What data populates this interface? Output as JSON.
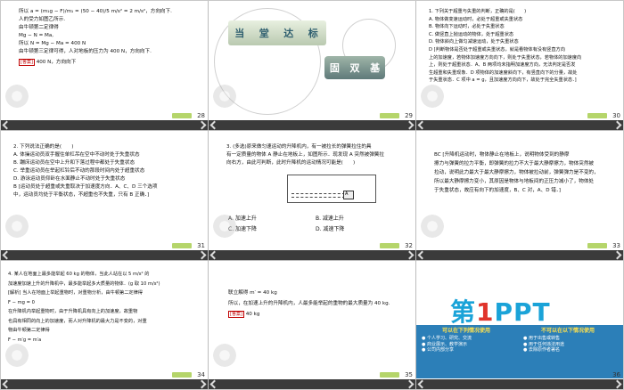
{
  "slides": [
    {
      "number": "28",
      "lines": [
        "所以 a = (m₁g − F)/m₁ = (50 − 40)/5 m/s² = 2 m/s²，方向向下.",
        "人的受力如图乙所示.",
        "由牛顿第二定律得",
        "Mg − N = Ma,",
        "所以 N = Mg − Ma = 400 N",
        "由牛顿第三定律可得，人对地板的压力为 400 N，方向向下."
      ],
      "answer_tag": "[答案]",
      "answer": "400 N，方向向下"
    },
    {
      "number": "29",
      "title_chars": [
        "当",
        "堂",
        "达",
        "标"
      ],
      "subtitle_chars": [
        "固",
        "双",
        "基"
      ]
    },
    {
      "number": "30",
      "lines": [
        "1. 下列关于超重与失重的判断，正确的是(　　)",
        "A. 物体做变速运动时，必处于超重或失重状态",
        "B. 物体向下运动时，必处于失重状态",
        "C. 做竖直上抛运动的物体，处于超重状态",
        "D. 物体斜向上做匀减速运动，处于失重状态",
        "D [判断物体是否处于超重或失重状态，就是看物体有没有竖直方向",
        "上的加速度，若物体加速度方向向下，则处于失重状态，若物体的加速度向",
        "上，则处于超重状态．A、B 两项均未指明加速度方向，无法判定是否发",
        "生超重和失重现象．D 项物体的加速度斜向下，有竖直向下的分量，故处",
        "于失重状态．C 项中 a = g，且加速度方向向下，故处于完全失重状态．]"
      ]
    },
    {
      "number": "31",
      "lines": [
        "2. 下列说法正确的是(　　)",
        "A. 体操运动员双手握住单杠吊在空中不动时处于失重状态",
        "B. 蹦床运动员在空中上升和下落过程中都处于失重状态",
        "C. 举重运动员在举起杠铃后不动的那段时间内处于超重状态",
        "D. 游泳运动员仰卧在水面静止不动时处于失重状态",
        "B [运动员处于超重或失重取决于加速度方向．A、C、D 三个选项",
        "中，运动员均处于平衡状态，不超重也不失重，只有 B 正确．]"
      ]
    },
    {
      "number": "32",
      "lines": [
        "3. (多选)原来做匀速运动的升降机内，有一被拉长的弹簧拉住的具",
        "有一定质量的物体 A 静止在地板上，如图所示．现发现 A 突然被弹簧拉",
        "向右方，由此可判断，此时升降机的运动情况可能是(　　)"
      ],
      "figure_label": "A",
      "options": [
        "A. 加速上升",
        "B. 减速上升",
        "C. 加速下降",
        "D. 减速下降"
      ]
    },
    {
      "number": "33",
      "lines": [
        "BC [升降机运动时，物体静止在地板上，说明物体受到的静摩",
        "擦力与弹簧的拉力平衡，即弹簧的拉力不大于最大静摩擦力，物体突然被",
        "拉动，说明此力最大于最大静摩擦力，物体被拉动前，弹簧弹力是不变的，",
        "所以最大静摩擦力变小，其原因是物体与地板间的正压力减小了，物体处",
        "于失重状态，故应有向下的加速度，B、C 对，A、D 错．]"
      ]
    },
    {
      "number": "34",
      "lines": [
        "4. 某人在地面上最多能举起 60 kg 的物体，当此人站在以 5 m/s² 的",
        "加速度加速上升的升降机中，最多能举起多大质量的物体．(g 取 10 m/s²)",
        "[解析] 当人在地面上举起重物时，对重物分析，由牛顿第二定律得",
        "F − mg = 0",
        "在升降机内举起重物时，由于升降机具有向上的加速度，故重物",
        "也具有相同的向上的加速度，而人对升降机的最大力是不变的，对重",
        "物由牛顿第二定律得",
        "F − m′g = m′a"
      ]
    },
    {
      "number": "35",
      "lines": [
        "联立解得 m′ = 40 kg",
        "所以，在加速上升的升降机内，人最多能举起的重物的最大质量为 40 kg."
      ],
      "answer_tag": "[答案]",
      "answer": "40 kg"
    },
    {
      "number": "36",
      "logo_first": "第",
      "logo_one": "1",
      "logo_rest": "PPT",
      "left_heading": "可以在下列情况使用",
      "left_items": [
        "● 个人学习、研究、交流",
        "● 商业展示、教学演示",
        "● 公司内部分享"
      ],
      "right_heading": "不可以在以下情况使用",
      "right_items": [
        "● 用于出售或转售",
        "● 用于任何违法用途",
        "● 去除原作者署名"
      ]
    }
  ]
}
